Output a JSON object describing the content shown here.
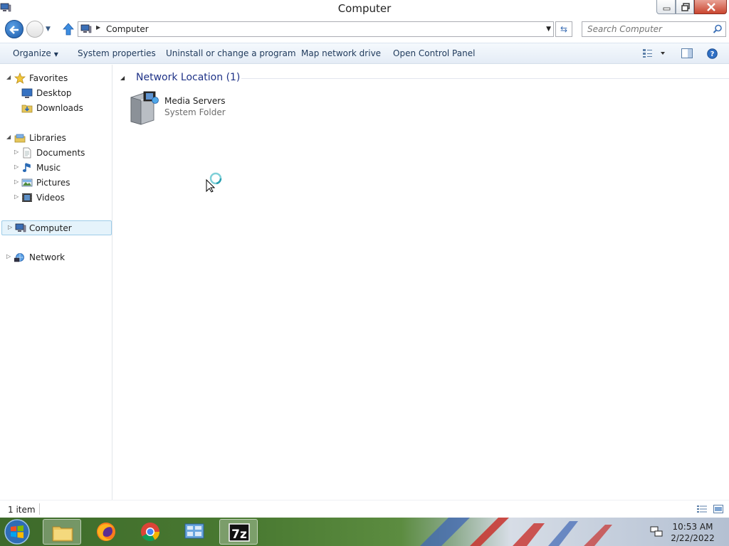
{
  "window": {
    "title": "Computer"
  },
  "address": {
    "breadcrumb": "Computer",
    "search_placeholder": "Search Computer"
  },
  "commands": {
    "organize": "Organize",
    "system_properties": "System properties",
    "uninstall": "Uninstall or change a program",
    "map_drive": "Map network drive",
    "control_panel": "Open Control Panel"
  },
  "nav_tree": {
    "favorites": "Favorites",
    "desktop": "Desktop",
    "downloads": "Downloads",
    "libraries": "Libraries",
    "documents": "Documents",
    "music": "Music",
    "pictures": "Pictures",
    "videos": "Videos",
    "computer": "Computer",
    "network": "Network"
  },
  "content": {
    "group_label": "Network Location (1)",
    "items": [
      {
        "name": "Media Servers",
        "type": "System Folder"
      }
    ]
  },
  "status": {
    "item_count": "1 item"
  },
  "taskbar": {
    "clock_time": "10:53 AM",
    "clock_date": "2/22/2022",
    "apps": [
      "file-explorer",
      "firefox",
      "chrome",
      "control-panel",
      "7zip"
    ]
  },
  "colors": {
    "accent_blue": "#1e3287",
    "selection": "#e5f3fb",
    "command_text": "#1e395b"
  }
}
